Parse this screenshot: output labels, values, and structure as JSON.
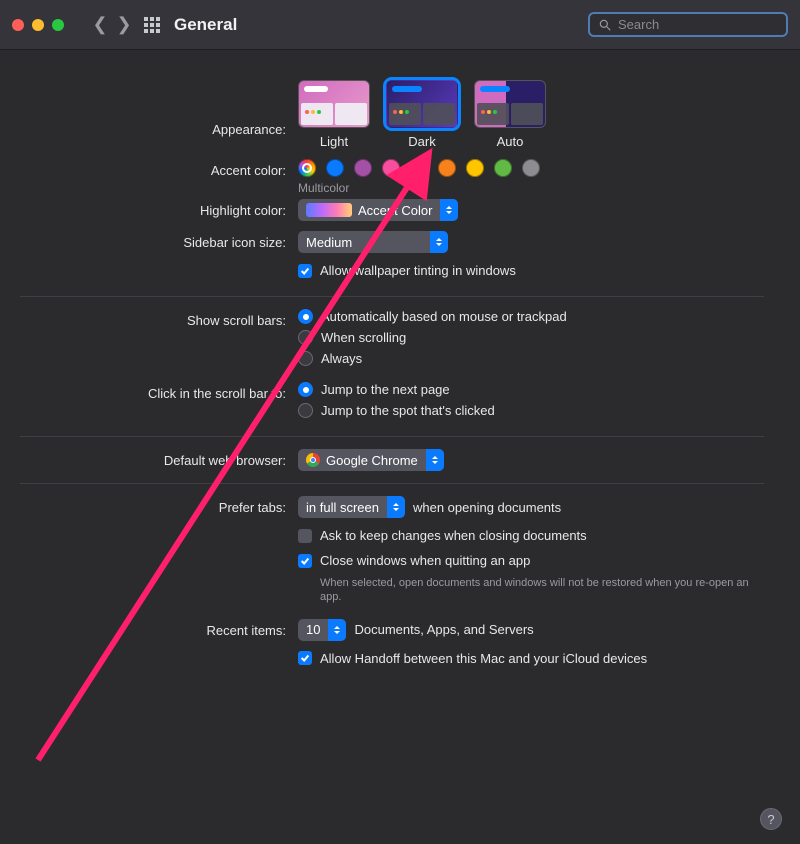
{
  "window": {
    "title": "General"
  },
  "search": {
    "placeholder": "Search"
  },
  "labels": {
    "appearance": "Appearance:",
    "accent": "Accent color:",
    "highlight": "Highlight color:",
    "sidebar_icon": "Sidebar icon size:",
    "scroll_bars": "Show scroll bars:",
    "scroll_click": "Click in the scroll bar to:",
    "browser": "Default web browser:",
    "tabs": "Prefer tabs:",
    "recent": "Recent items:"
  },
  "appearance": {
    "options": [
      {
        "label": "Light",
        "selected": false
      },
      {
        "label": "Dark",
        "selected": true
      },
      {
        "label": "Auto",
        "selected": false
      }
    ]
  },
  "accent": {
    "selected_label": "Multicolor",
    "colors": [
      "multicolor",
      "#0a7aff",
      "#a550a7",
      "#f74f9e",
      "#ff5257",
      "#f7821b",
      "#ffc600",
      "#62ba46",
      "#8c8c91"
    ]
  },
  "highlight": {
    "value": "Accent Color"
  },
  "sidebar_icon": {
    "value": "Medium"
  },
  "wallpaper_tint": {
    "checked": true,
    "label": "Allow wallpaper tinting in windows"
  },
  "scroll_bars": {
    "options": [
      {
        "label": "Automatically based on mouse or trackpad",
        "on": true
      },
      {
        "label": "When scrolling",
        "on": false
      },
      {
        "label": "Always",
        "on": false
      }
    ]
  },
  "scroll_click": {
    "options": [
      {
        "label": "Jump to the next page",
        "on": true
      },
      {
        "label": "Jump to the spot that's clicked",
        "on": false
      }
    ]
  },
  "browser": {
    "value": "Google Chrome"
  },
  "tabs": {
    "value": "in full screen",
    "suffix": "when opening documents",
    "ask_changes": {
      "checked": false,
      "label": "Ask to keep changes when closing documents"
    },
    "close_windows": {
      "checked": true,
      "label": "Close windows when quitting an app",
      "note": "When selected, open documents and windows will not be restored when you re-open an app."
    }
  },
  "recent": {
    "value": "10",
    "suffix": "Documents, Apps, and Servers",
    "handoff": {
      "checked": true,
      "label": "Allow Handoff between this Mac and your iCloud devices"
    }
  }
}
